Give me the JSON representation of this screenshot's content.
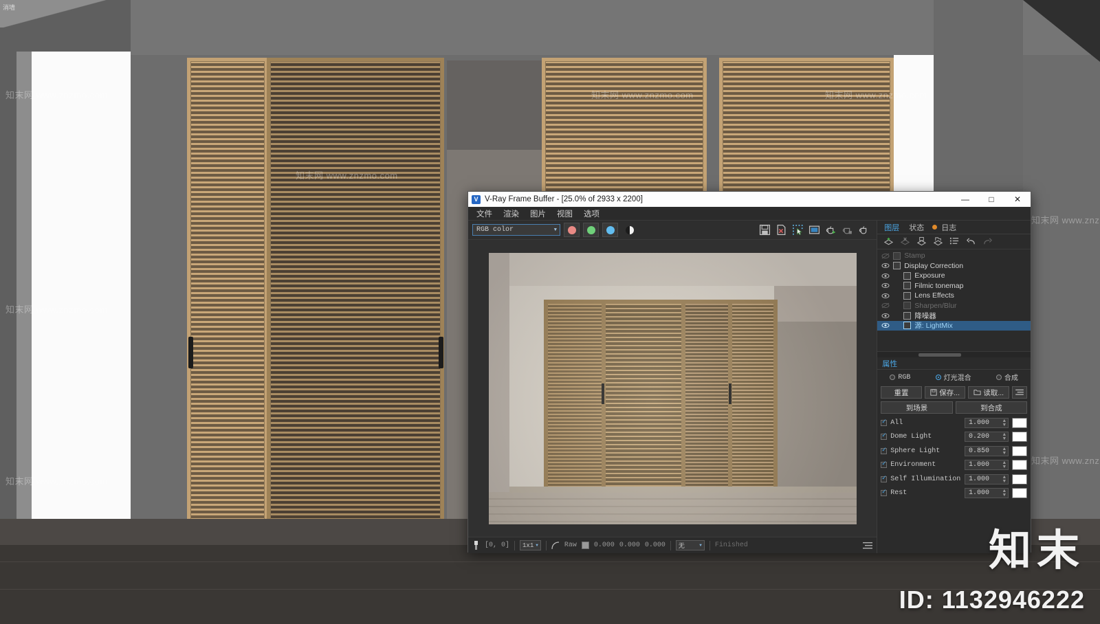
{
  "background": {
    "corner_label": "消墙",
    "watermarks": [
      "知末网 www.znzmo.com",
      "知末网 www.znzmo.com",
      "知末网 www.znzmo.com",
      "知末网 www.znzmo.com",
      "知末网 www.znzmo.com",
      "知末网 www.znzmo.com",
      "知末网 www.znzmo.com",
      "知末网 www.znzmo.com",
      "知末网 www.znzmo.com"
    ],
    "site_logo": "知末",
    "asset_id": "ID: 1132946222"
  },
  "window": {
    "title": "V-Ray Frame Buffer - [25.0% of 2933 x 2200]",
    "app_icon": "vray-icon",
    "controls": {
      "minimize": "—",
      "maximize": "□",
      "close": "✕"
    },
    "menu": [
      "文件",
      "渲染",
      "图片",
      "视图",
      "选项"
    ]
  },
  "toolbar": {
    "channel_select": "RGB color",
    "channel_buttons": [
      {
        "name": "red-channel",
        "color": "#e98a85"
      },
      {
        "name": "green-channel",
        "color": "#6fd07a"
      },
      {
        "name": "blue-channel",
        "color": "#62bdf0"
      },
      {
        "name": "alpha-channel",
        "color": "#f2f2f2"
      }
    ],
    "right_icons": [
      "save-image-icon",
      "save-vrimg-icon",
      "region-render-icon",
      "track-mouse-icon",
      "render-last-icon",
      "abort-render-icon",
      "render-icon"
    ]
  },
  "statusbar": {
    "pixel_coords": "[0,  0]",
    "sample_size": "1x1",
    "mode_label": "Raw",
    "values": [
      "0.000",
      "0.000",
      "0.000"
    ],
    "lut_select": "无",
    "state": "Finished"
  },
  "dock": {
    "tabs": [
      {
        "label": "图层",
        "active": true,
        "dot": false
      },
      {
        "label": "状态",
        "active": false,
        "dot": false
      },
      {
        "label": "日志",
        "active": false,
        "dot": true
      }
    ],
    "layer_tools": [
      "add-layer-icon",
      "remove-layer-icon",
      "save-layers-icon",
      "load-layers-icon",
      "layer-presets-icon",
      "undo-icon",
      "redo-icon"
    ],
    "layers": [
      {
        "label": "Stamp",
        "visible": false,
        "indent": 0,
        "selected": false,
        "icon": "stamp-icon"
      },
      {
        "label": "Display Correction",
        "visible": true,
        "indent": 0,
        "selected": false,
        "icon": "display-correction-icon"
      },
      {
        "label": "Exposure",
        "visible": true,
        "indent": 1,
        "selected": false,
        "icon": "exposure-icon"
      },
      {
        "label": "Filmic tonemap",
        "visible": true,
        "indent": 1,
        "selected": false,
        "icon": "filmic-tonemap-icon"
      },
      {
        "label": "Lens Effects",
        "visible": true,
        "indent": 1,
        "selected": false,
        "icon": "lens-effects-icon"
      },
      {
        "label": "Sharpen/Blur",
        "visible": false,
        "indent": 1,
        "selected": false,
        "icon": "sharpen-blur-icon"
      },
      {
        "label": "降噪器",
        "visible": true,
        "indent": 1,
        "selected": false,
        "icon": "denoiser-icon"
      },
      {
        "label": "源: LightMix",
        "visible": true,
        "indent": 1,
        "selected": true,
        "icon": "lightmix-icon"
      }
    ]
  },
  "properties": {
    "tab_label": "属性",
    "modes": [
      {
        "label": "RGB",
        "selected": false
      },
      {
        "label": "灯光混合",
        "selected": true
      },
      {
        "label": "合成",
        "selected": false
      }
    ],
    "actions": {
      "reset": "重置",
      "save": "保存...",
      "load": "读取...",
      "menu_icon": "list-menu-icon",
      "to_scene": "到场景",
      "to_composite": "到合成"
    },
    "lightmix": [
      {
        "name": "All",
        "enabled": true,
        "value": "1.000",
        "color": "#ffffff"
      },
      {
        "name": "Dome Light",
        "enabled": true,
        "value": "0.200",
        "color": "#ffffff"
      },
      {
        "name": "Sphere Light",
        "enabled": true,
        "value": "0.850",
        "color": "#ffffff"
      },
      {
        "name": "Environment",
        "enabled": true,
        "value": "1.000",
        "color": "#ffffff"
      },
      {
        "name": "Self Illumination",
        "enabled": true,
        "value": "1.000",
        "color": "#ffffff"
      },
      {
        "name": "Rest",
        "enabled": true,
        "value": "1.000",
        "color": "#ffffff"
      }
    ]
  },
  "colors": {
    "accent": "#4aa3e0",
    "window_bg": "#2b2b2b",
    "selection": "#2f5c86",
    "log_dot": "#e08a2a"
  }
}
